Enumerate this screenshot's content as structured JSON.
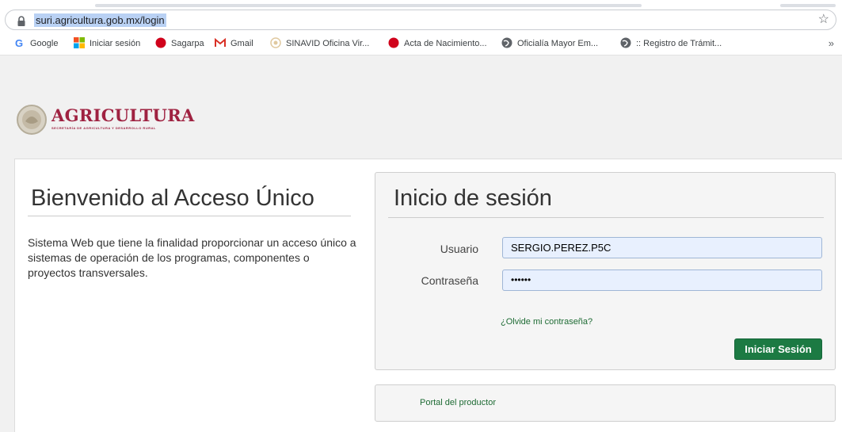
{
  "browser": {
    "url": "suri.agricultura.gob.mx/login",
    "bookmarks": [
      {
        "label": "Google",
        "icon": "google-icon"
      },
      {
        "label": "Iniciar sesión",
        "icon": "microsoft-icon"
      },
      {
        "label": "Sagarpa",
        "icon": "red-circle-icon"
      },
      {
        "label": "Gmail",
        "icon": "gmail-icon"
      },
      {
        "label": "SINAVID Oficina Vir...",
        "icon": "seal-icon"
      },
      {
        "label": "Acta de Nacimiento...",
        "icon": "red-circle-icon"
      },
      {
        "label": "Oficialía Mayor Em...",
        "icon": "globe-icon"
      },
      {
        "label": ":: Registro de Trámit...",
        "icon": "globe-icon"
      }
    ],
    "more": "»"
  },
  "brand": {
    "name": "AGRICULTURA",
    "subtitle": "SECRETARÍA DE AGRICULTURA Y DESARROLLO RURAL",
    "color": "#9f2241"
  },
  "welcome": {
    "title": "Bienvenido al Acceso Único",
    "description": "Sistema Web que tiene la finalidad proporcionar un acceso único a sistemas de operación de los programas, componentes o proyectos transversales."
  },
  "login": {
    "title": "Inicio de sesión",
    "user_label": "Usuario",
    "user_value": "SERGIO.PEREZ.P5C",
    "password_label": "Contraseña",
    "password_value": "••••••",
    "forgot_link": "¿Olvide mi contraseña?",
    "submit_label": "Iniciar Sesión",
    "button_color": "#1c7a43"
  },
  "producer": {
    "link": "Portal del productor"
  }
}
